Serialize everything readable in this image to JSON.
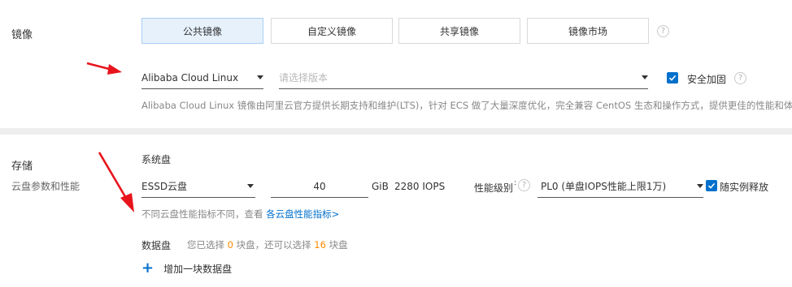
{
  "image_section": {
    "label": "镜像",
    "tabs": [
      {
        "label": "公共镜像",
        "active": true
      },
      {
        "label": "自定义镜像",
        "active": false
      },
      {
        "label": "共享镜像",
        "active": false
      },
      {
        "label": "镜像市场",
        "active": false
      }
    ],
    "os_select_value": "Alibaba Cloud Linux",
    "version_select_placeholder": "请选择版本",
    "security_hardening_label": "安全加固",
    "security_hardening_checked": true,
    "description": "Alibaba Cloud Linux 镜像由阿里云官方提供长期支持和维护(LTS)，针对 ECS 做了大量深度优化，完全兼容 CentOS 生态和操作方式，提供更佳的性能和体"
  },
  "storage_section": {
    "label": "存储",
    "sublabel": "云盘参数和性能",
    "system_disk_label": "系统盘",
    "disk_type_value": "ESSD云盘",
    "disk_size_value": "40",
    "size_unit": "GiB",
    "iops": "2280 IOPS",
    "perf_level_label": "性能级别",
    "perf_level_value": "PL0 (单盘IOPS性能上限1万)",
    "release_with_instance_label": "随实例释放",
    "release_with_instance_checked": true,
    "perf_note_prefix": "不同云盘性能指标不同，查看 ",
    "perf_note_link": "各云盘性能指标>",
    "data_disk_label": "数据盘",
    "data_disk_note_a": "您已选择 ",
    "data_disk_selected": "0",
    "data_disk_note_b": " 块盘，还可以选择 ",
    "data_disk_remaining": "16",
    "data_disk_note_c": " 块盘",
    "add_data_disk_label": "增加一块数据盘"
  },
  "colors": {
    "accent": "#0070cc",
    "arrow": "#e8141b",
    "highlight_number": "#ff8a00"
  }
}
